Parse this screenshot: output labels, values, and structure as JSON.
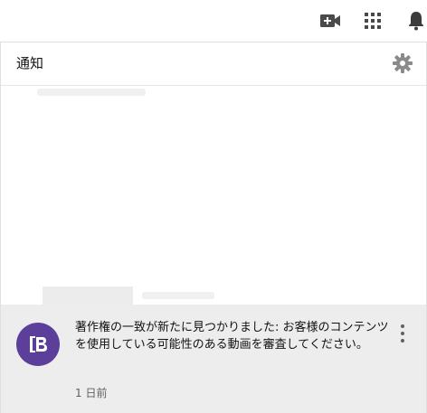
{
  "panel": {
    "title": "通知"
  },
  "icons": {
    "create": "video-camera-plus-icon",
    "apps": "apps-grid-icon",
    "notifications": "bell-icon",
    "settings": "gear-icon",
    "more": "more-vertical-icon",
    "avatar": "channel-logo-b"
  },
  "notification": {
    "message": "著作権の一致が新たに見つかりました: お客様のコンテンツを使用している可能性のある動画を審査してください。",
    "time": "1 日前"
  },
  "colors": {
    "avatar_bg": "#5b3f9a",
    "toast_bg": "#ececec",
    "icon": "#606060"
  }
}
